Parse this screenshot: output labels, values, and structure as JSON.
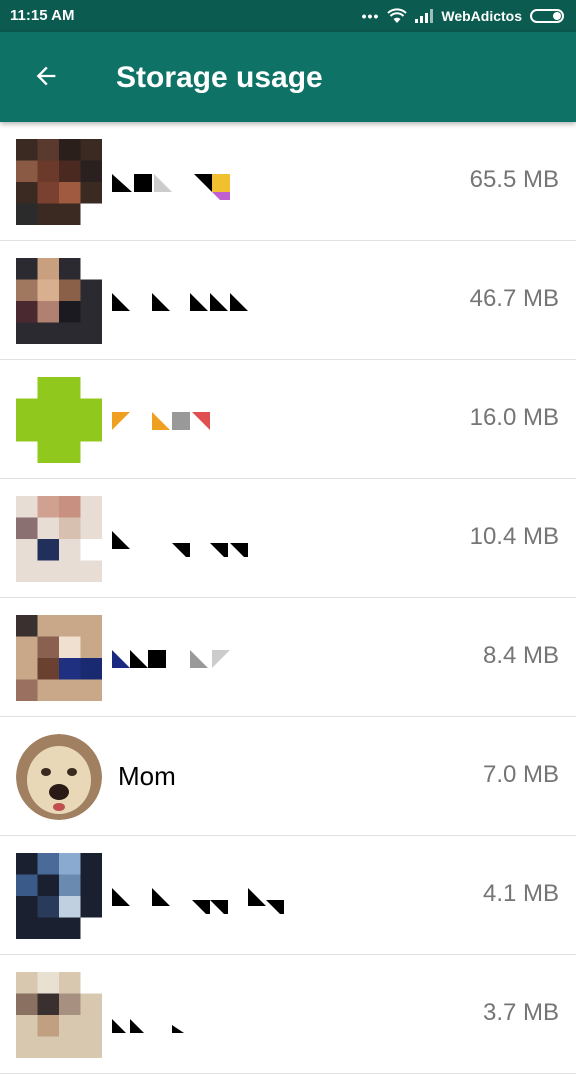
{
  "status_bar": {
    "time": "11:15 AM",
    "carrier": "WebAdictos",
    "dots": "•••"
  },
  "app_bar": {
    "title": "Storage usage",
    "back_icon": "arrow-left-icon"
  },
  "colors": {
    "status_bar": "#0b5b50",
    "app_bar": "#0e7366",
    "size_text": "#757575"
  },
  "chats": [
    {
      "name": "",
      "size": "65.5 MB",
      "avatar": "pixelated"
    },
    {
      "name": "",
      "size": "46.7 MB",
      "avatar": "pixelated"
    },
    {
      "name": "",
      "size": "16.0 MB",
      "avatar": "pixelated"
    },
    {
      "name": "",
      "size": "10.4 MB",
      "avatar": "pixelated"
    },
    {
      "name": "",
      "size": "8.4 MB",
      "avatar": "pixelated"
    },
    {
      "name": "Mom",
      "size": "7.0 MB",
      "avatar": "dog-photo"
    },
    {
      "name": "",
      "size": "4.1 MB",
      "avatar": "pixelated"
    },
    {
      "name": "",
      "size": "3.7 MB",
      "avatar": "pixelated"
    }
  ]
}
